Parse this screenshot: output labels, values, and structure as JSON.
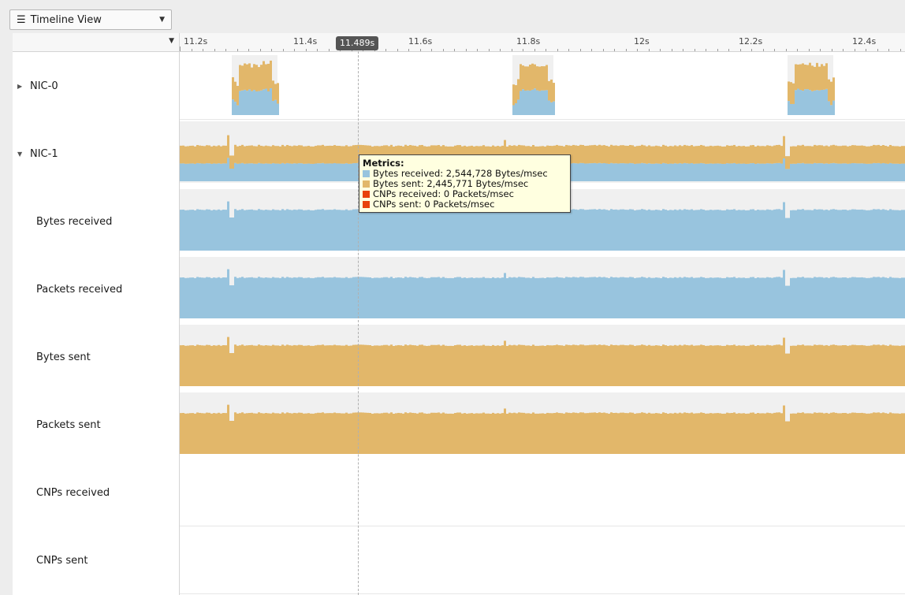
{
  "toolbar": {
    "view_selector": {
      "label": "Timeline View",
      "menu_icon": "menu-icon",
      "caret_icon": "chevron-down-icon"
    }
  },
  "colors": {
    "bytes_received": "#98c4de",
    "bytes_sent": "#e2b76a",
    "cnps_received": "#e8420c",
    "cnps_sent": "#e8420c",
    "track_background": "#f0f0f0"
  },
  "axis": {
    "ticks": [
      "11.2s",
      "11.4s",
      "11.6s",
      "11.8s",
      "12s",
      "12.2s",
      "12.4s"
    ],
    "cursor_label": "11.489s"
  },
  "rows": [
    {
      "label": "NIC-0",
      "expander": "collapsed"
    },
    {
      "label": "NIC-1",
      "expander": "expanded"
    },
    {
      "label": "Bytes received"
    },
    {
      "label": "Packets received"
    },
    {
      "label": "Bytes sent"
    },
    {
      "label": "Packets sent"
    },
    {
      "label": "CNPs received"
    },
    {
      "label": "CNPs sent"
    }
  ],
  "tooltip": {
    "title": "Metrics:",
    "items": [
      {
        "text": "Bytes received: 2,544,728 Bytes/msec",
        "color": "#98c4de"
      },
      {
        "text": "Bytes sent: 2,445,771 Bytes/msec",
        "color": "#e2b76a"
      },
      {
        "text": "CNPs received: 0 Packets/msec",
        "color": "#e8420c"
      },
      {
        "text": "CNPs sent: 0 Packets/msec",
        "color": "#e8420c"
      }
    ]
  }
}
